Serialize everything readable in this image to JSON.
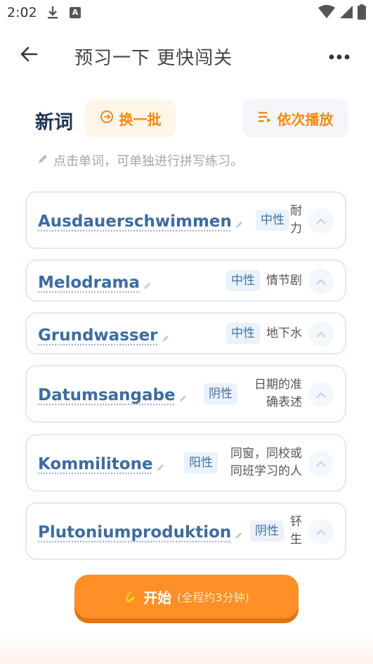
{
  "status_bar": {
    "time": "2:02",
    "icon_a": "A"
  },
  "header": {
    "title": "预习一下 更快闯关"
  },
  "section": {
    "title": "新词",
    "refresh_label": "换一批",
    "play_label": "依次播放",
    "hint": "点击单词，可单独进行拼写练习。"
  },
  "words": [
    {
      "word": "Ausdauerschwimmen",
      "gender": "中性",
      "meaning_lines": [
        "耐",
        "力"
      ]
    },
    {
      "word": "Melodrama",
      "gender": "中性",
      "meaning_lines": [
        "情节剧"
      ]
    },
    {
      "word": "Grundwasser",
      "gender": "中性",
      "meaning_lines": [
        "地下水"
      ]
    },
    {
      "word": "Datumsangabe",
      "gender": "阴性",
      "meaning_lines": [
        "日期的准",
        "确表述"
      ]
    },
    {
      "word": "Kommilitone",
      "gender": "阳性",
      "meaning_lines": [
        "同窗，同校或",
        "同班学习的人"
      ]
    },
    {
      "word": "Plutoniumproduktion",
      "gender": "阴性",
      "meaning_lines": [
        "钚",
        "生"
      ]
    }
  ],
  "start": {
    "icon": "💪",
    "label": "开始",
    "sub": "(全程约3分钟)"
  },
  "colors": {
    "accent": "#ff8f26",
    "word": "#3d6c9e",
    "title": "#1d3557"
  }
}
